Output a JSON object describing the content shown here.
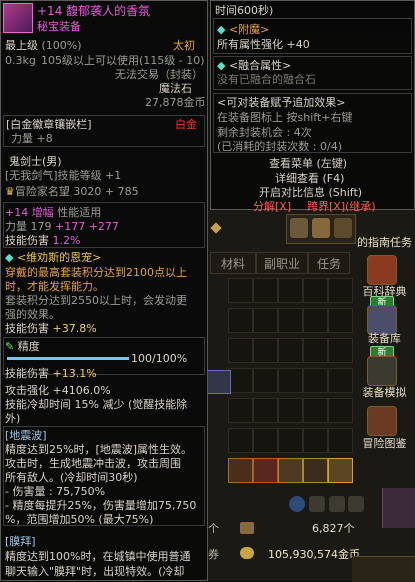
{
  "main_tip": {
    "item_name": "+14 馥郁袭人的香氛",
    "item_type": "秘宝装备",
    "level_label": "最上级",
    "level_pct": "(100%)",
    "rarity": "太初",
    "weight": "0.3kg",
    "level_req": "105级以上可以使用(115级 - 10)",
    "trade": "无法交易（封装）",
    "enhance_type": "魔法石",
    "price": "27,878金币",
    "emblem_title": "[白金徽章镶嵌栏]",
    "emblem_color": "白金",
    "emblem_stat": "力量 +8",
    "job_line": "鬼剑士(男)",
    "skill_lv": "[无我剑气]技能等级 +1",
    "fame": "冒险家名望  3020 + 785",
    "amp_line_a": "+14 增幅",
    "amp_line_b": "性能适用",
    "str_label": "力量",
    "str_val": "179",
    "str_bonus_a": "+177",
    "str_bonus_b": "+277",
    "skill_dmg_label": "技能伤害",
    "skill_dmg_val": "1.2%",
    "grace_title": "<维劝斯的恩宠>",
    "grace_1": "穿戴的最高套装积分达到2100点以上",
    "grace_2": "时，才能发挥能力。",
    "grace_3": "套装积分达到2550以上时，会发动更",
    "grace_4": "强的效果。",
    "grace_dmg_label": "技能伤害",
    "grace_dmg_val": "+37.8%",
    "precision_label": "精度",
    "precision_val": "100/100%",
    "precision_pct": 100,
    "skill_dmg2_label": "技能伤害",
    "skill_dmg2_val": "+13.1%",
    "atk_label": "攻击强化",
    "atk_val": "+4106.0%",
    "cd_line": "技能冷却时间 15% 减少 (觉醒技能除",
    "cd_line2": "外)",
    "quake_title": "[地震波]",
    "quake_1": "精度达到25%时，[地震波]属性生效。",
    "quake_2": "攻击时，生成地震冲击波，攻击周围",
    "quake_3": "所有敌人。(冷却时间30秒)",
    "quake_4": "- 伤害量 : 75,750%",
    "quake_5": "- 精度每提升25%，伤害量增加75,750",
    "quake_6": "%，范围增加50% (最大75%)",
    "shout_title": "[膜拜]",
    "shout_1": "精度达到100%时，在城镇中使用普通",
    "shout_2": "聊天输入\"膜拜\"时，出现特效。(冷却"
  },
  "side_tip": {
    "time": "时间600秒)",
    "enchant_title": "<附魔>",
    "enchant_stat": "所有属性强化 +40",
    "fusion_title": "<融合属性>",
    "fusion_none": "没有已融合的融合石",
    "seal_title": "<可对装备赋予追加效果>",
    "seal_hint": "在装备图标上 按shift+右键",
    "seal_remain": "剩余封装机会 : 4次",
    "seal_used": "(已消耗的封装次数 : 0/4)",
    "view_menu": "查看菜单 (左键)",
    "detail": "详细查看 (F4)",
    "compare": "开启对比信息 (Shift)",
    "split": "分解[X]",
    "cross": "跨界[X](继承)"
  },
  "inventory": {
    "tabs": [
      "材料",
      "副职业",
      "任务"
    ],
    "count": "6,827个",
    "count_prefix": "个",
    "gold": "105,930,574金币",
    "gold_prefix": "券",
    "guide_text": "的指南任务",
    "side_buttons": [
      "百科辞典",
      "装备库",
      "装备模拟",
      "冒险图鉴"
    ],
    "new_badge": "新"
  }
}
